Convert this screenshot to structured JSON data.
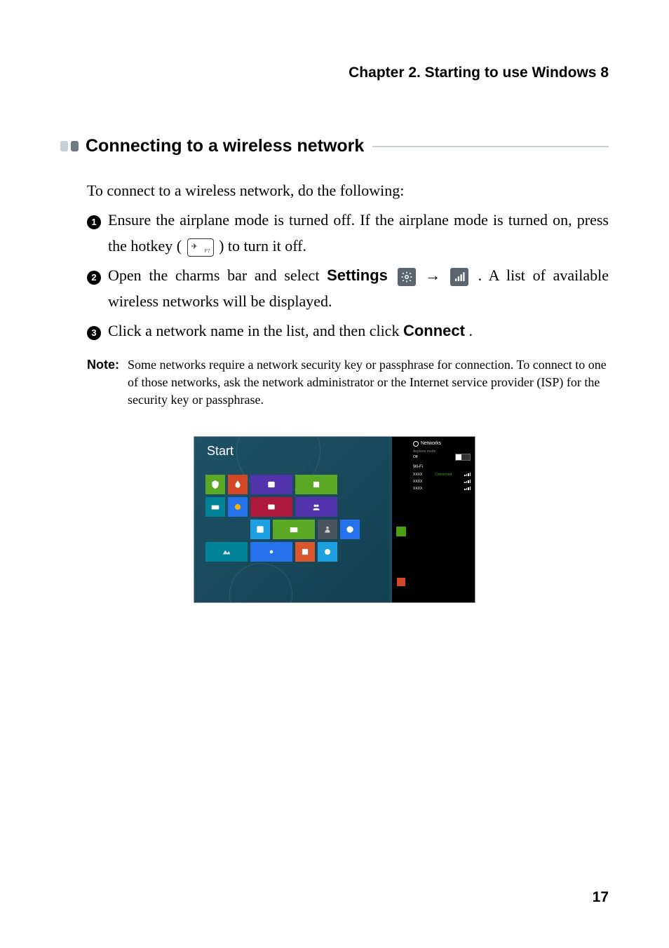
{
  "chapter": "Chapter 2. Starting to use Windows 8",
  "section_title": "Connecting to a wireless network",
  "intro": "To connect to a wireless network, do the following:",
  "steps": [
    {
      "num": "1",
      "pre": "Ensure the airplane mode is turned off. If the airplane mode is turned on, press the hotkey (",
      "post": ") to turn it off."
    },
    {
      "num": "2",
      "pre": "Open the charms bar and select ",
      "bold1": "Settings",
      "mid": " → ",
      "post": " . A list of available wireless networks will be displayed."
    },
    {
      "num": "3",
      "pre": "Click a network name in the list, and then click ",
      "bold1": "Connect",
      "post": "."
    }
  ],
  "note_label": "Note:",
  "note_text": "Some networks require a network security key or passphrase for connection. To connect to one of those networks, ask the network administrator or the Internet service provider (ISP) for the security key or passphrase.",
  "screenshot": {
    "start": "Start",
    "networks_title": "Networks",
    "airplane_label": "Airplane mode",
    "airplane_state": "Off",
    "wifi_label": "Wi-Fi",
    "items": [
      {
        "name": "XXXX",
        "status": "Connected"
      },
      {
        "name": "XXXX",
        "status": ""
      },
      {
        "name": "XXXX",
        "status": ""
      }
    ],
    "tile_colors": {
      "green": "#5ba825",
      "orange": "#d24726",
      "teal": "#008299",
      "blue": "#2672ec",
      "purple": "#5133ab",
      "red": "#ac193d",
      "dorange": "#dc572e",
      "yellow": "#f3b200",
      "sky": "#1ba1e2",
      "grey": "#4b545c"
    }
  },
  "page_number": "17"
}
